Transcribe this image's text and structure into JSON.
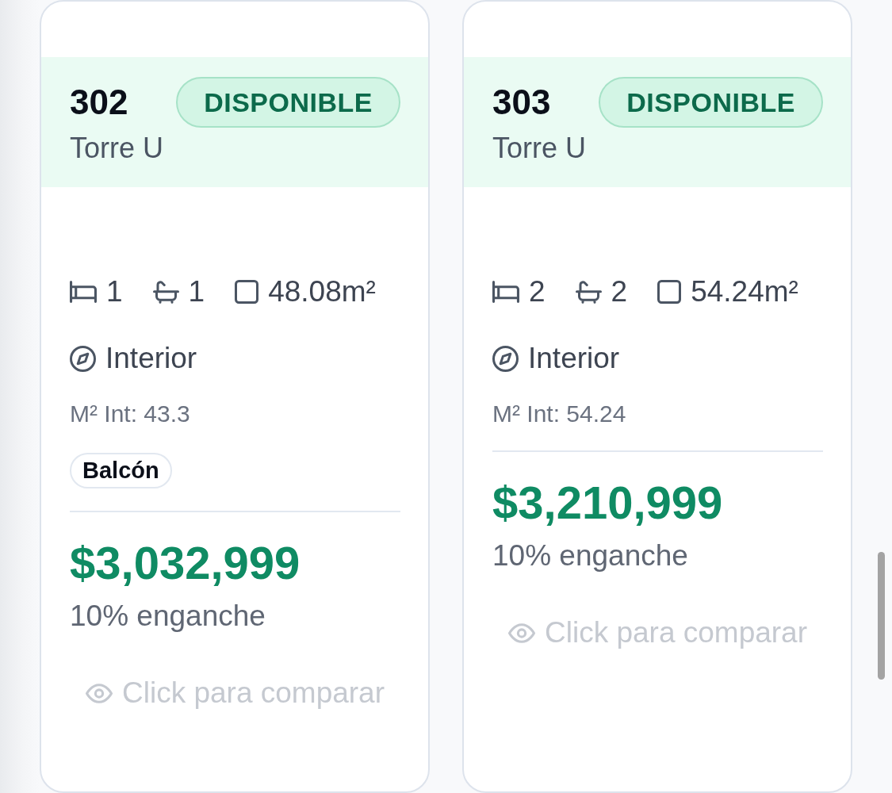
{
  "units": [
    {
      "number": "302",
      "status": {
        "label": "DISPONIBLE",
        "kind": "available"
      },
      "tower": "Torre U",
      "bedrooms": "1",
      "bathrooms": "1",
      "area": "48.08m²",
      "orientation": "Interior",
      "interior_area": "M² Int: 43.3",
      "tags": [
        "Balcón"
      ],
      "price": "$3,032,999",
      "down_payment": "10% enganche",
      "compare_hint": "Click para comparar"
    },
    {
      "number": "303",
      "status": {
        "label": "DISPONIBLE",
        "kind": "available"
      },
      "tower": "Torre U",
      "bedrooms": "2",
      "bathrooms": "2",
      "area": "54.24m²",
      "orientation": "Interior",
      "interior_area": "M² Int: 54.24",
      "price": "$3,210,999",
      "down_payment": "10% enganche",
      "compare_hint": "Click para comparar"
    }
  ]
}
